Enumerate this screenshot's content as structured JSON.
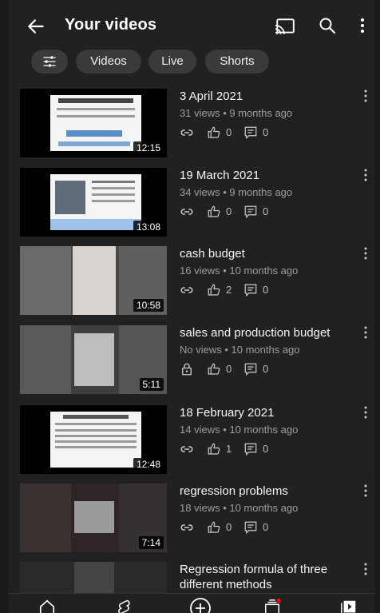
{
  "header": {
    "title": "Your videos"
  },
  "filters": [
    "Videos",
    "Live",
    "Shorts"
  ],
  "videos": [
    {
      "title": "3 April 2021",
      "meta": "31 views • 9 months ago",
      "duration": "12:15",
      "likes": "0",
      "comments": "0",
      "visibility": "link-icon"
    },
    {
      "title": "19 March 2021",
      "meta": "34 views • 9 months ago",
      "duration": "13:08",
      "likes": "0",
      "comments": "0",
      "visibility": "link-icon"
    },
    {
      "title": "cash budget",
      "meta": "16 views • 10 months ago",
      "duration": "10:58",
      "likes": "2",
      "comments": "0",
      "visibility": "link-icon"
    },
    {
      "title": "sales and production budget",
      "meta": "No views • 10 months ago",
      "duration": "5:11",
      "likes": "0",
      "comments": "0",
      "visibility": "lock-icon"
    },
    {
      "title": "18 February 2021",
      "meta": "14 views • 10 months ago",
      "duration": "12:48",
      "likes": "1",
      "comments": "0",
      "visibility": "link-icon"
    },
    {
      "title": "regression problems",
      "meta": "18 views • 10 months ago",
      "duration": "7:14",
      "likes": "0",
      "comments": "0",
      "visibility": "link-icon"
    },
    {
      "title": "Regression formula of three different methods",
      "meta": "",
      "duration": "",
      "likes": "",
      "comments": "",
      "visibility": ""
    }
  ],
  "colors": {
    "background": "#212121",
    "chip": "#3a3a3a",
    "text": "#f5f5f5",
    "subtext": "#9d9d9d",
    "accent": "#ff0000"
  },
  "bottom_nav": [
    "home-icon",
    "shorts-icon",
    "create-icon",
    "subscriptions-icon",
    "library-icon"
  ]
}
